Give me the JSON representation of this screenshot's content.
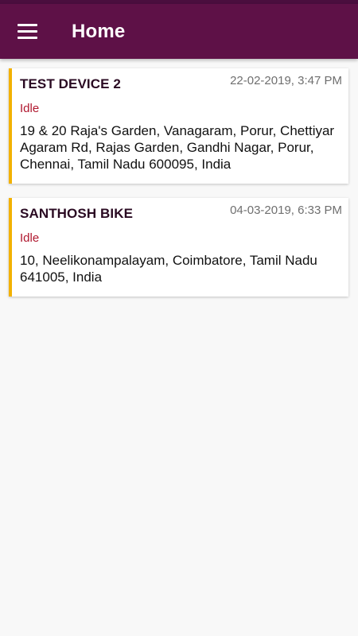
{
  "colors": {
    "app_bar": "#5e1147",
    "status_strip": "#4a0e3e",
    "card_accent": "#f2b100",
    "status_text": "#b0182f",
    "background": "#f8f8f8"
  },
  "header": {
    "menu_icon": "hamburger-menu-icon",
    "title": "Home"
  },
  "devices": [
    {
      "name": "TEST DEVICE 2",
      "timestamp": "22-02-2019, 3:47 PM",
      "status": "Idle",
      "address": "19 & 20 Raja's Garden, Vanagaram, Porur, Chettiyar Agaram Rd, Rajas Garden, Gandhi Nagar, Porur, Chennai, Tamil Nadu 600095, India"
    },
    {
      "name": "SANTHOSH BIKE",
      "timestamp": "04-03-2019, 6:33 PM",
      "status": "Idle",
      "address": "10, Neelikonampalayam, Coimbatore, Tamil Nadu 641005, India"
    }
  ]
}
